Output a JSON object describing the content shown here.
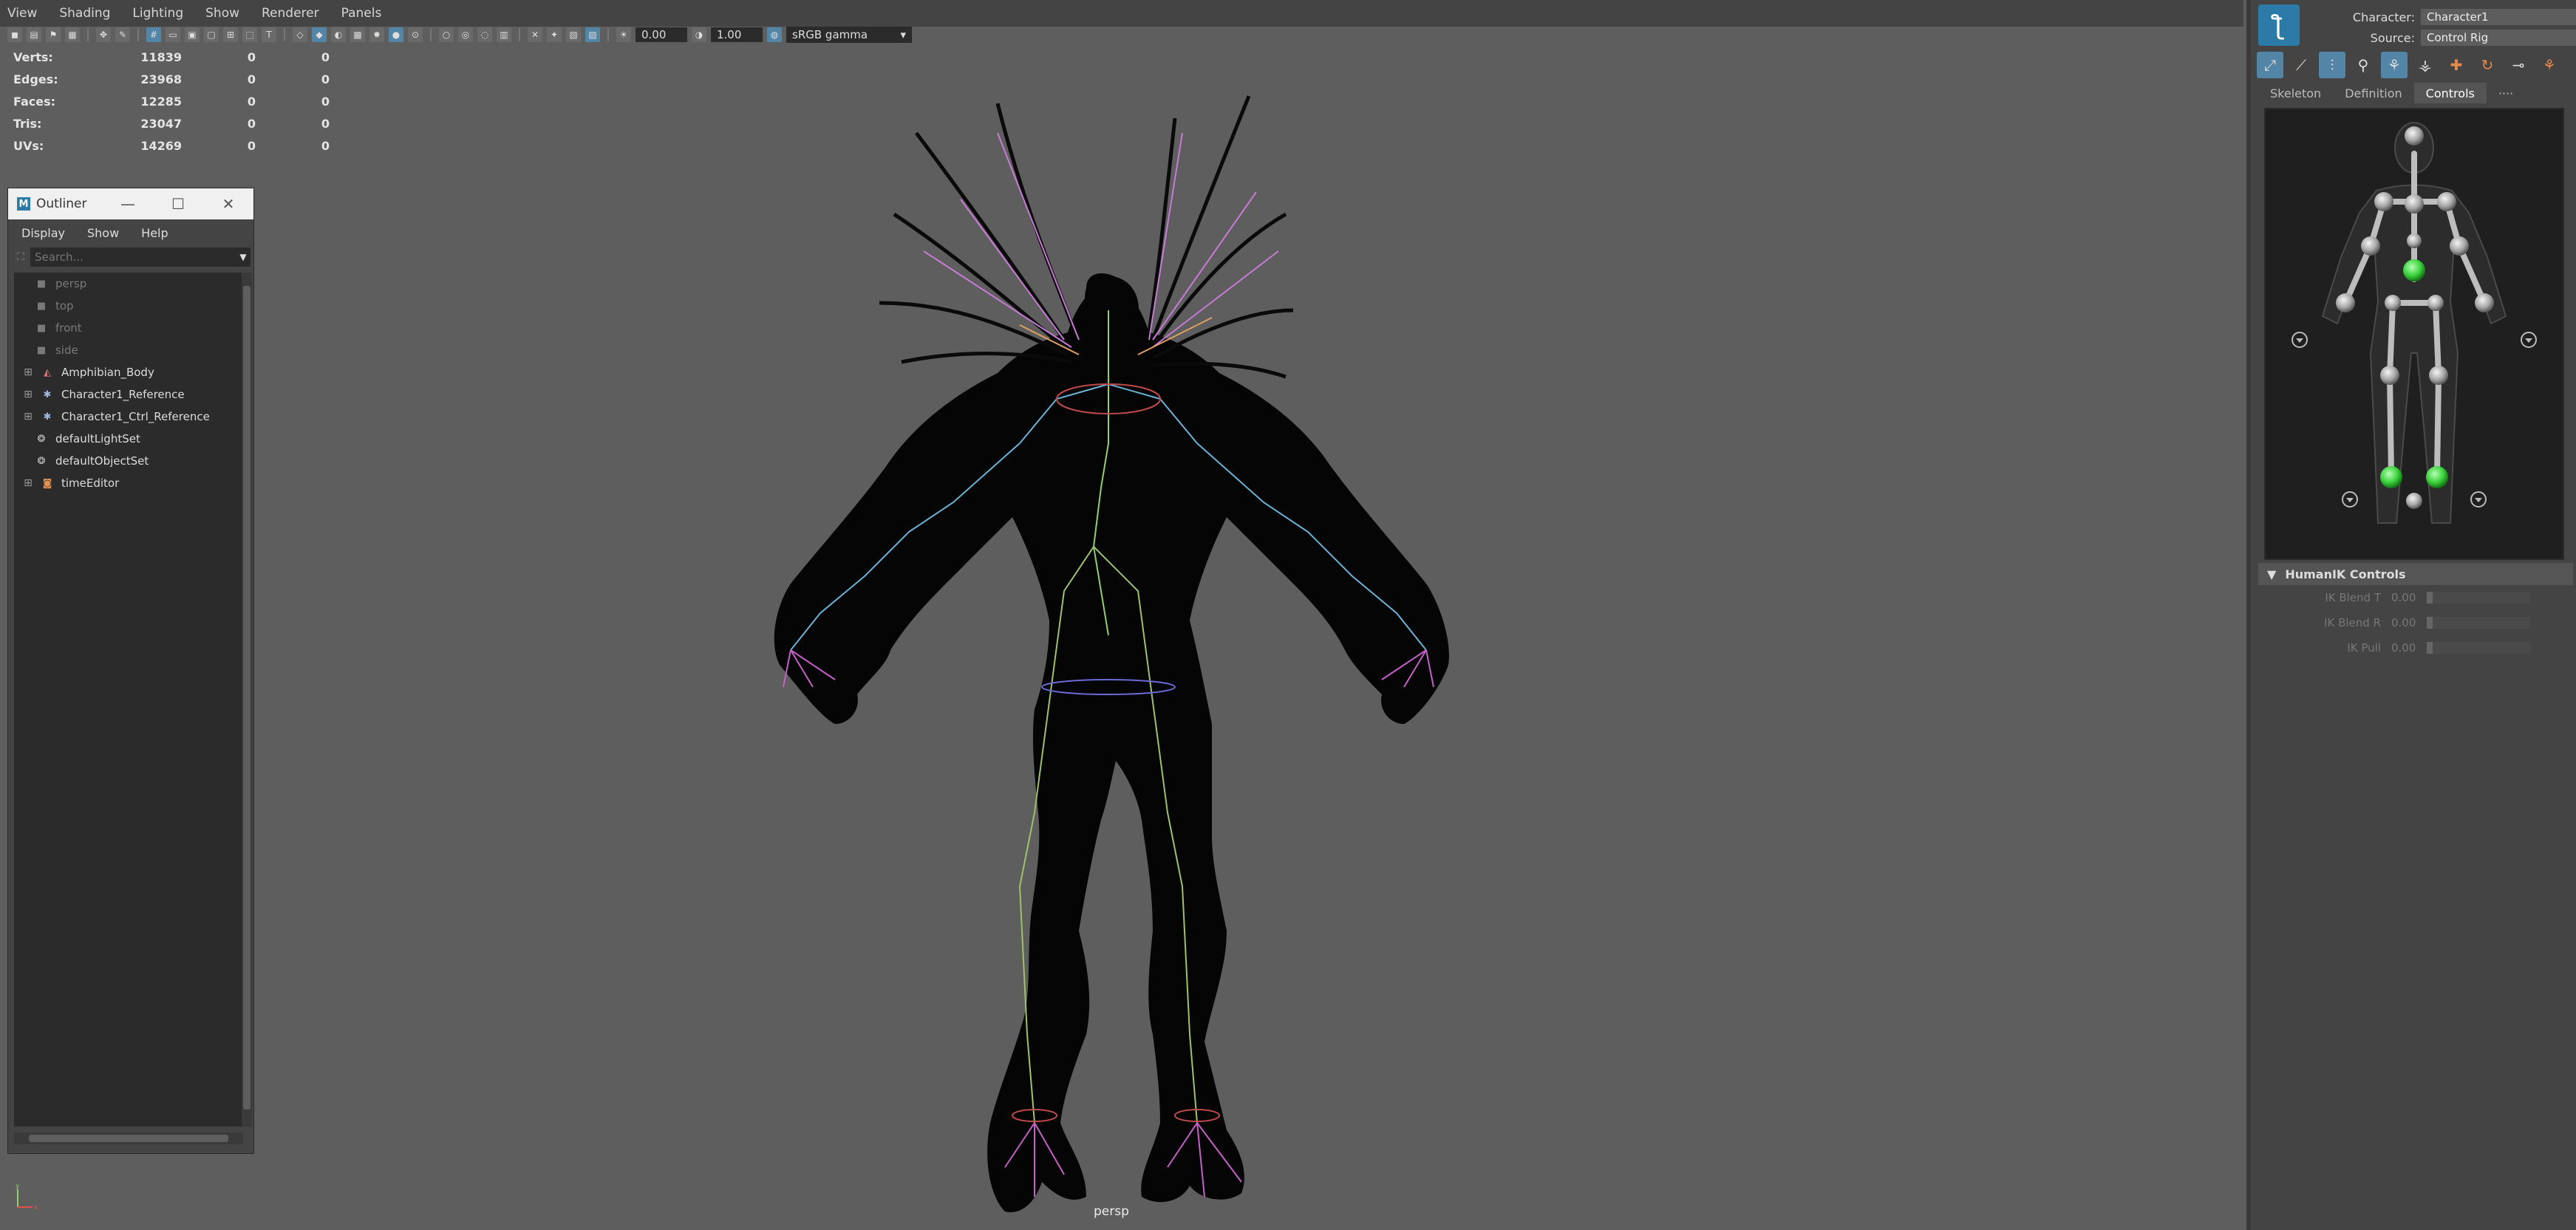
{
  "viewport": {
    "menus": [
      "View",
      "Shading",
      "Lighting",
      "Show",
      "Renderer",
      "Panels"
    ],
    "exposure_value": "0.00",
    "gamma_value": "1.00",
    "colorspace": "sRGB gamma",
    "camera_label": "persp",
    "axis_y": "y",
    "axis_x": "x",
    "hud": [
      {
        "label": "Verts:",
        "v1": "11839",
        "v2": "0",
        "v3": "0"
      },
      {
        "label": "Edges:",
        "v1": "23968",
        "v2": "0",
        "v3": "0"
      },
      {
        "label": "Faces:",
        "v1": "12285",
        "v2": "0",
        "v3": "0"
      },
      {
        "label": "Tris:",
        "v1": "23047",
        "v2": "0",
        "v3": "0"
      },
      {
        "label": "UVs:",
        "v1": "14269",
        "v2": "0",
        "v3": "0"
      }
    ]
  },
  "outliner": {
    "title": "Outliner",
    "logo": "M",
    "menus": [
      "Display",
      "Show",
      "Help"
    ],
    "search_placeholder": "Search...",
    "items": [
      {
        "label": "persp",
        "icon": "camera-icon"
      },
      {
        "label": "top",
        "icon": "camera-icon"
      },
      {
        "label": "front",
        "icon": "camera-icon"
      },
      {
        "label": "side",
        "icon": "camera-icon"
      },
      {
        "label": "Amphibian_Body",
        "icon": "mesh-icon"
      },
      {
        "label": "Character1_Reference",
        "icon": "joint-icon"
      },
      {
        "label": "Character1_Ctrl_Reference",
        "icon": "joint-icon"
      },
      {
        "label": "defaultLightSet",
        "icon": "set-icon"
      },
      {
        "label": "defaultObjectSet",
        "icon": "set-icon"
      },
      {
        "label": "timeEditor",
        "icon": "time-editor-icon"
      }
    ]
  },
  "humanik": {
    "character_label": "Character:",
    "character_value": "Character1",
    "source_label": "Source:",
    "source_value": "Control Rig",
    "tabs": [
      "Skeleton",
      "Definition",
      "Controls",
      "····"
    ],
    "active_tab": "Controls",
    "section_title": "HumanIK Controls",
    "params": [
      {
        "label": "IK Blend T",
        "value": "0.00"
      },
      {
        "label": "IK Blend R",
        "value": "0.00"
      },
      {
        "label": "IK Pull",
        "value": "0.00"
      }
    ]
  },
  "colors": {
    "viewport_bg": "#5e5e5e",
    "panel_bg": "#444444",
    "accent_blue": "#5285a6",
    "effector_green": "#3cd23c"
  }
}
